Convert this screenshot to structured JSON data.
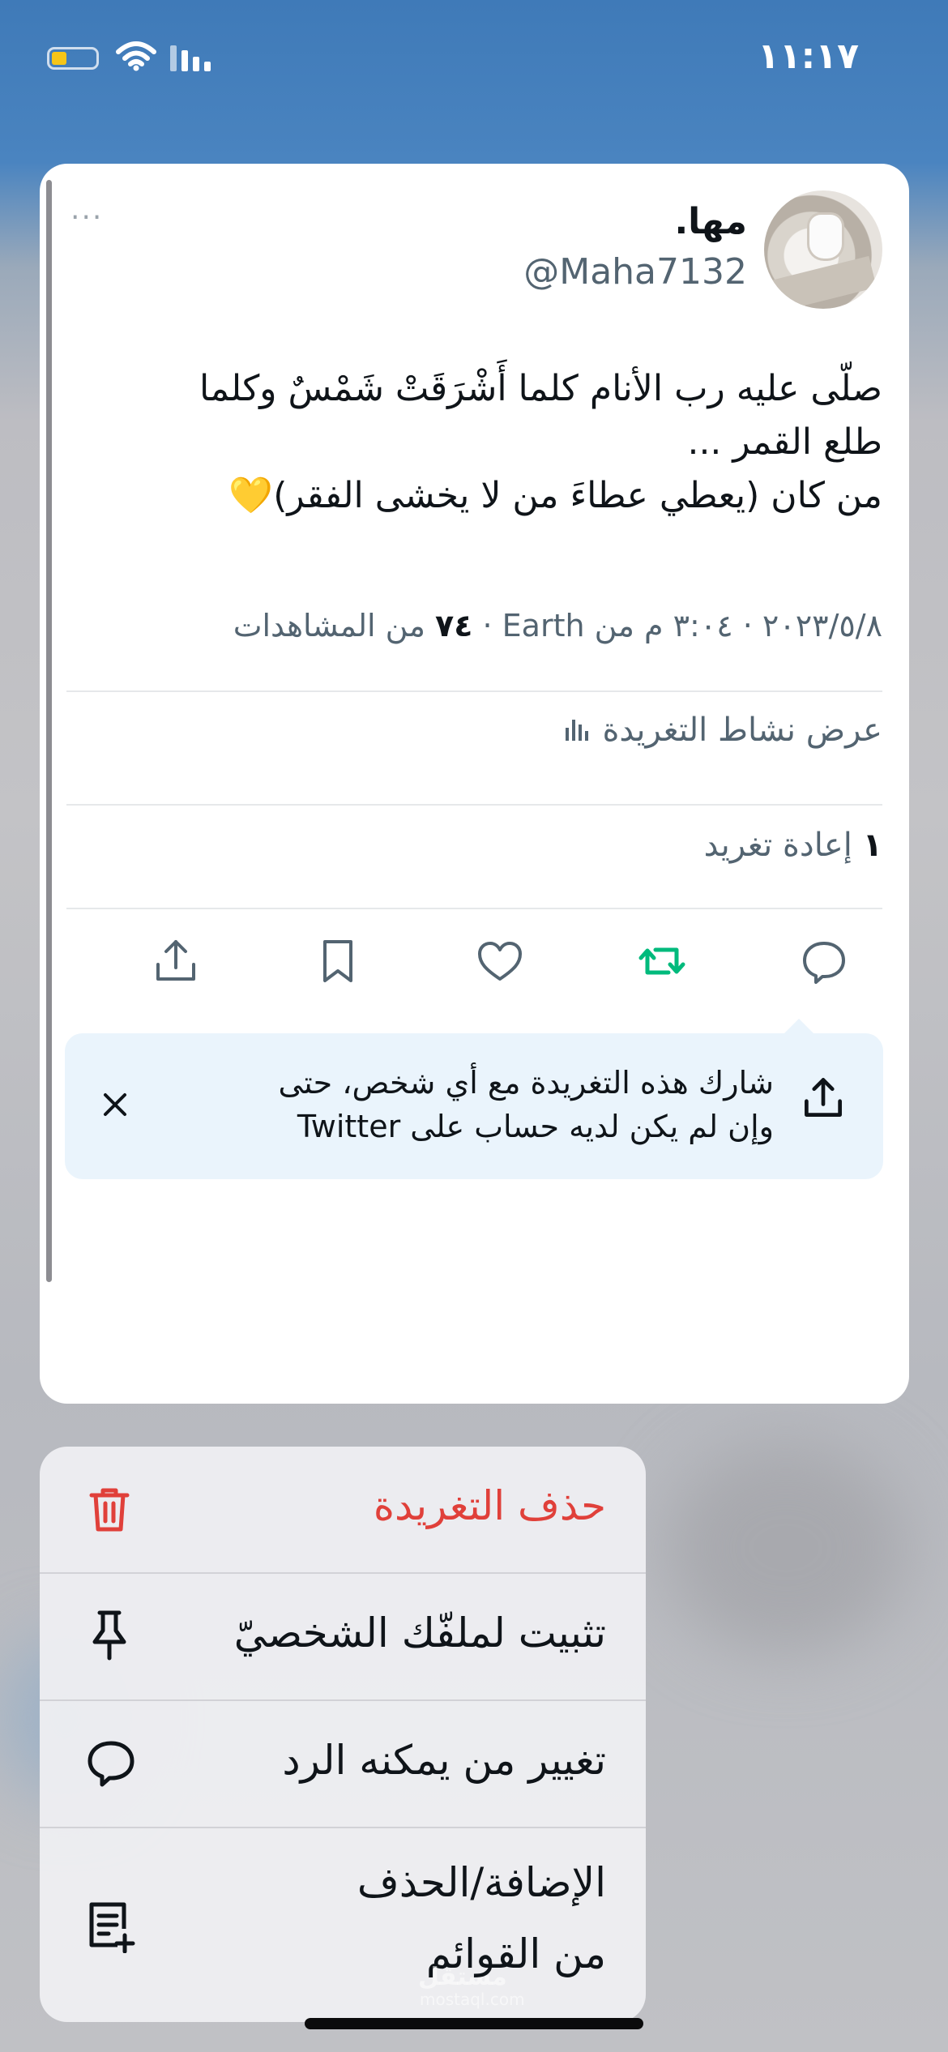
{
  "status_bar": {
    "time": "١١:١٧"
  },
  "tweet": {
    "author_name": "مها.",
    "author_handle": "@Maha7132",
    "more_label": "···",
    "body_lines": [
      "صلّى عليه رب الأنام كلما أَشْرَقَتْ شَمْسٌ وكلما",
      "طلع القمر ...",
      "من كان (يعطي عطاءَ من لا يخشى الفقر)💛"
    ],
    "meta": {
      "datetime": "٢٠٢٣/٥/٨ · ٣:٠٤ م من Earth · ",
      "views_count": "٧٤",
      "views_label": " من المشاهدات"
    },
    "activity_label": "عرض نشاط التغريدة",
    "retweets": {
      "count": "١",
      "label": " إعادة تغريد"
    },
    "actions": [
      "reply",
      "retweet",
      "like",
      "bookmark",
      "share"
    ],
    "retweet_color": "#00ba7c",
    "share_tip": {
      "line1": "شارك هذه التغريدة مع أي شخص، حتى",
      "line2": "وإن لم يكن لديه حساب على Twitter"
    }
  },
  "menu": {
    "items": [
      {
        "label": "حذف التغريدة",
        "icon": "trash-icon",
        "color": "#f4212e"
      },
      {
        "label": "تثبيت لملفّك الشخصيّ",
        "icon": "pin-icon"
      },
      {
        "label": "تغيير من يمكنه الرد",
        "icon": "speech-bubble-icon"
      },
      {
        "label_line1": "الإضافة/الحذف",
        "label_line2": "من القوائم",
        "icon": "list-add-icon"
      }
    ]
  },
  "watermark": {
    "line1": "مستقل",
    "line2": "mostaql.com"
  }
}
